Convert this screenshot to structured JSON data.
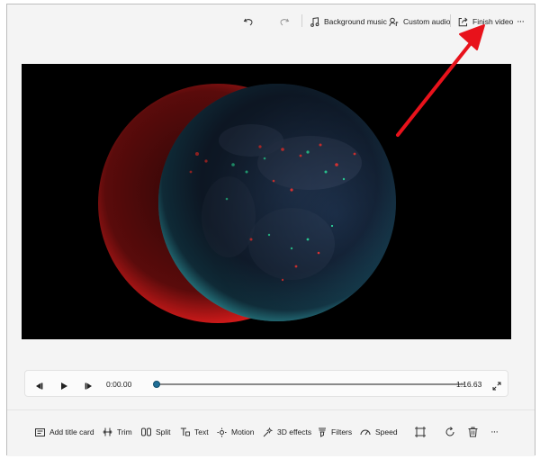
{
  "toolbar": {
    "undo_icon": "undo-icon",
    "redo_icon": "redo-icon",
    "background_music_label": "Background music",
    "custom_audio_label": "Custom audio",
    "finish_video_label": "Finish video",
    "more_label": "···"
  },
  "player": {
    "current_time": "0:00.00",
    "total_time": "1:16.63",
    "progress": 0.0
  },
  "tools": {
    "add_title_card": "Add title card",
    "trim": "Trim",
    "split": "Split",
    "text": "Text",
    "motion": "Motion",
    "effects_3d": "3D effects",
    "filters": "Filters",
    "speed": "Speed",
    "more_label": "···"
  },
  "colors": {
    "annotation_arrow": "#e8121b",
    "scrubber_thumb": "#1f6e96",
    "preview_background": "#000000"
  }
}
